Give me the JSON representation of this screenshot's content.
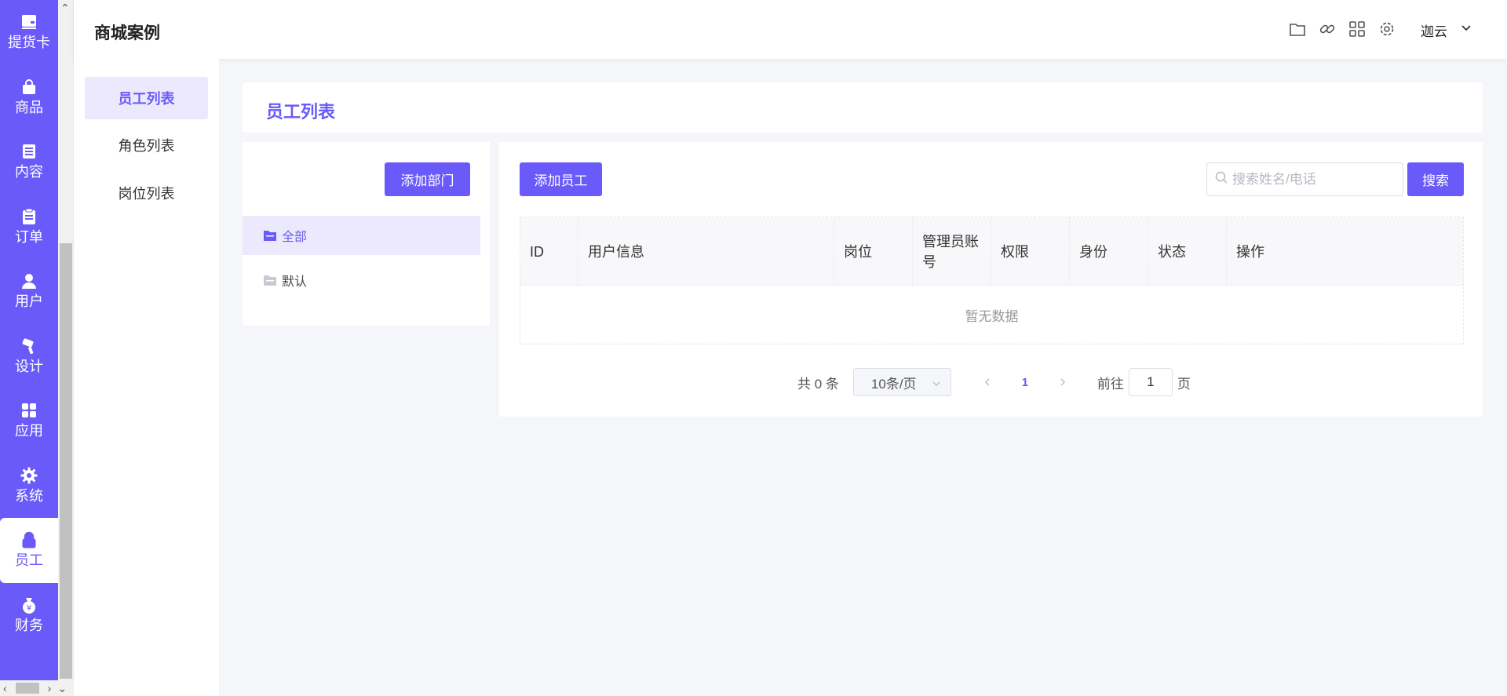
{
  "app": {
    "title": "商城案例"
  },
  "iconbar": {
    "items": [
      {
        "label": "提货卡",
        "icon": "card-icon"
      },
      {
        "label": "商品",
        "icon": "bag-icon"
      },
      {
        "label": "内容",
        "icon": "list-icon"
      },
      {
        "label": "订单",
        "icon": "clipboard-icon"
      },
      {
        "label": "用户",
        "icon": "user-icon"
      },
      {
        "label": "设计",
        "icon": "brush-icon"
      },
      {
        "label": "应用",
        "icon": "grid-icon"
      },
      {
        "label": "系统",
        "icon": "gear-icon"
      },
      {
        "label": "员工",
        "icon": "lock-icon",
        "active": true
      },
      {
        "label": "财务",
        "icon": "money-bag-icon"
      }
    ]
  },
  "header": {
    "icons": [
      "folder-icon",
      "link-icon",
      "apps-icon",
      "settings-icon"
    ],
    "username": "迦云"
  },
  "subnav": {
    "items": [
      {
        "label": "员工列表",
        "active": true
      },
      {
        "label": "角色列表"
      },
      {
        "label": "岗位列表"
      }
    ]
  },
  "page": {
    "title": "员工列表"
  },
  "departments": {
    "add_label": "添加部门",
    "items": [
      {
        "label": "全部",
        "active": true
      },
      {
        "label": "默认"
      }
    ]
  },
  "employees": {
    "add_label": "添加员工",
    "search": {
      "placeholder": "搜索姓名/电话",
      "value": "",
      "button_label": "搜索"
    },
    "columns": [
      "ID",
      "用户信息",
      "岗位",
      "管理员账号",
      "权限",
      "身份",
      "状态",
      "操作"
    ],
    "empty_text": "暂无数据",
    "pagination": {
      "total_label": "共 0 条",
      "page_size": "10条/页",
      "current_page": "1",
      "goto_label": "前往",
      "goto_value": "1",
      "page_unit": "页"
    }
  },
  "colors": {
    "accent": "#6a5af9",
    "accent_light": "#ece9fd"
  }
}
